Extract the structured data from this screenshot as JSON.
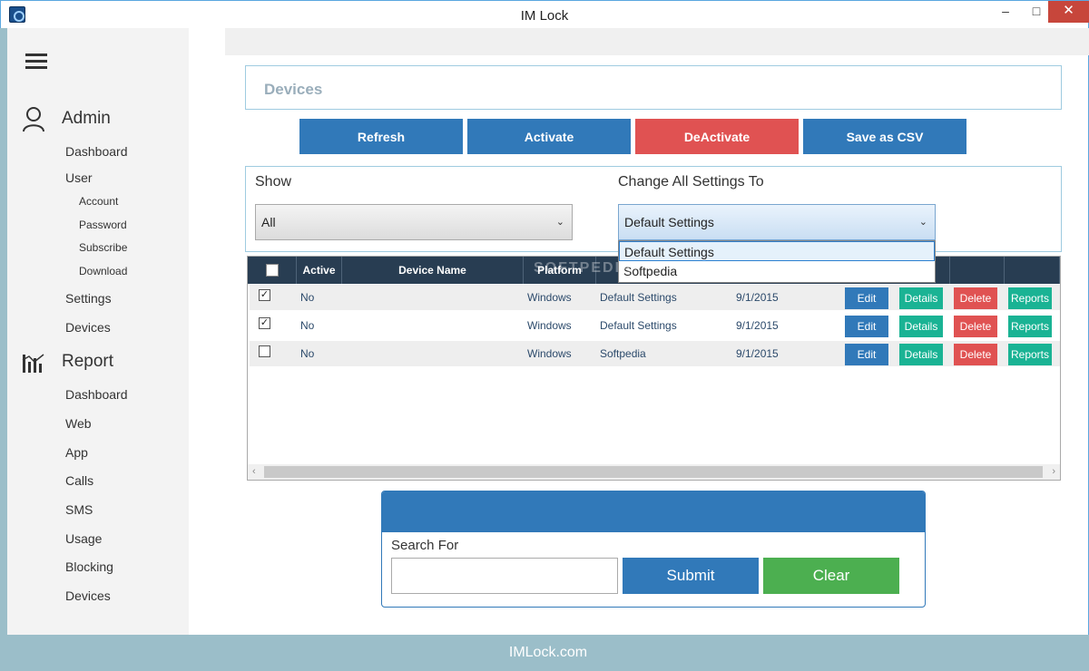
{
  "window": {
    "title": "IM Lock",
    "minimize": "‒",
    "maximize": "□",
    "close": "✕"
  },
  "sidebar": {
    "admin_label": "Admin",
    "admin_items": [
      "Dashboard",
      "User"
    ],
    "user_sub_items": [
      "Account",
      "Password",
      "Subscribe",
      "Download"
    ],
    "admin_items_after": [
      "Settings",
      "Devices"
    ],
    "report_label": "Report",
    "report_items": [
      "Dashboard",
      "Web",
      "App",
      "Calls",
      "SMS",
      "Usage",
      "Blocking",
      "Devices"
    ]
  },
  "page": {
    "title": "Devices"
  },
  "actions": {
    "refresh": "Refresh",
    "activate": "Activate",
    "deactivate": "DeActivate",
    "save_csv": "Save as CSV"
  },
  "filters": {
    "show_label": "Show",
    "show_value": "All",
    "change_label": "Change All Settings To",
    "change_value": "Default Settings",
    "change_options": [
      "Default Settings",
      "Softpedia"
    ]
  },
  "table": {
    "headers": [
      "Active",
      "Device Name",
      "Platform"
    ],
    "rows": [
      {
        "checked": true,
        "active": "No",
        "device": "",
        "platform": "Windows",
        "settings": "Default Settings",
        "date": "9/1/2015"
      },
      {
        "checked": true,
        "active": "No",
        "device": "",
        "platform": "Windows",
        "settings": "Default Settings",
        "date": "9/1/2015"
      },
      {
        "checked": false,
        "active": "No",
        "device": "",
        "platform": "Windows",
        "settings": "Softpedia",
        "date": "9/1/2015"
      }
    ],
    "row_buttons": {
      "edit": "Edit",
      "details": "Details",
      "delete": "Delete",
      "reports": "Reports"
    }
  },
  "search": {
    "label": "Search For",
    "value": "",
    "submit": "Submit",
    "clear": "Clear"
  },
  "footer": {
    "text": "IMLock.com"
  },
  "watermark": "SOFTPEDIA"
}
